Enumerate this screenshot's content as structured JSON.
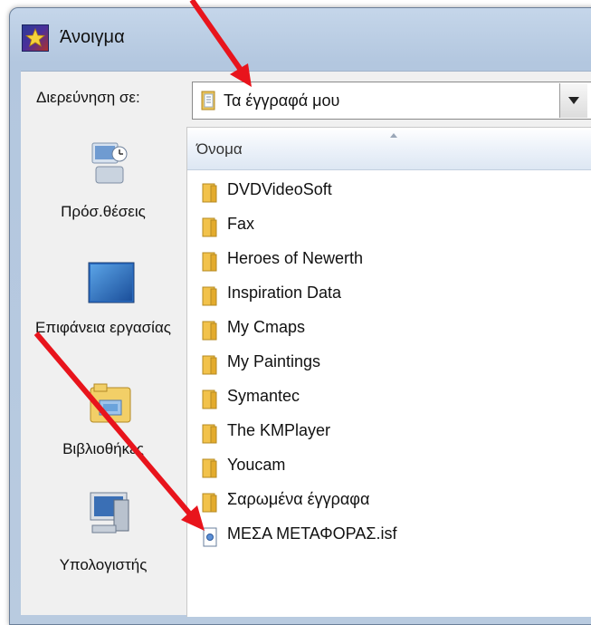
{
  "dialog": {
    "title": "Άνοιγμα"
  },
  "lookin": {
    "label": "Διερεύνηση σε:",
    "value": "Τα έγγραφά μου"
  },
  "places": [
    {
      "label": "Πρόσ.θέσεις",
      "icon": "recent-places-icon"
    },
    {
      "label": "Επιφάνεια εργασίας",
      "icon": "desktop-icon"
    },
    {
      "label": "Βιβλιοθήκες",
      "icon": "libraries-icon"
    },
    {
      "label": "Υπολογιστής",
      "icon": "computer-icon"
    }
  ],
  "filelist": {
    "column_name": "Όνομα",
    "items": [
      {
        "name": "DVDVideoSoft",
        "type": "folder"
      },
      {
        "name": "Fax",
        "type": "folder"
      },
      {
        "name": "Heroes of Newerth",
        "type": "folder"
      },
      {
        "name": "Inspiration Data",
        "type": "folder"
      },
      {
        "name": "My Cmaps",
        "type": "folder"
      },
      {
        "name": "My Paintings",
        "type": "folder"
      },
      {
        "name": "Symantec",
        "type": "folder"
      },
      {
        "name": "The KMPlayer",
        "type": "folder"
      },
      {
        "name": "Youcam",
        "type": "folder"
      },
      {
        "name": "Σαρωμένα έγγραφα",
        "type": "folder"
      },
      {
        "name": "ΜΕΣΑ ΜΕΤΑΦΟΡΑΣ.isf",
        "type": "file"
      }
    ]
  },
  "colors": {
    "annotation_arrow": "#e8141c",
    "folder": "#f2c24b",
    "header": "#dde7f3"
  }
}
